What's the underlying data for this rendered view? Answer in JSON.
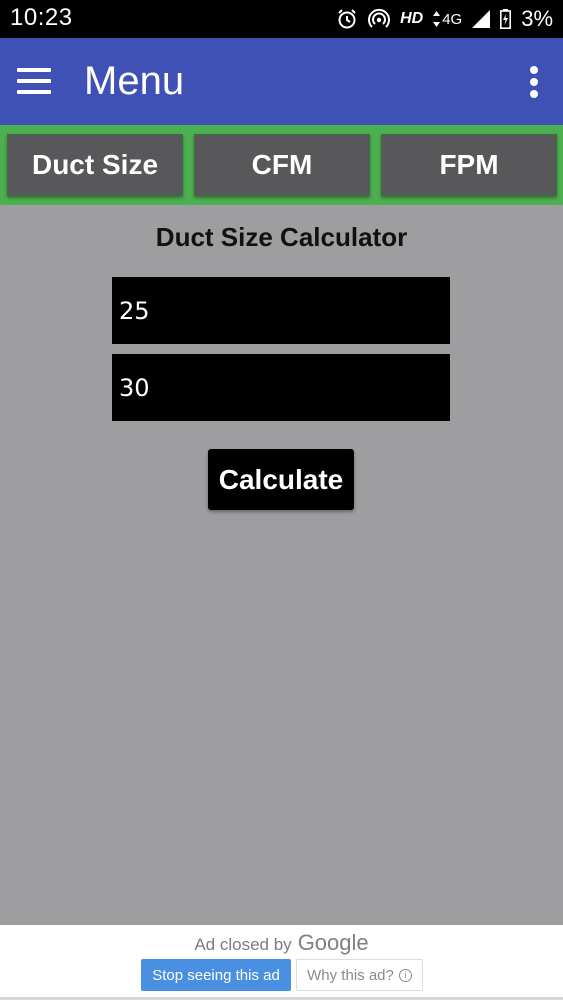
{
  "status_bar": {
    "time": "10:23",
    "network_label": "HD",
    "network_type": "4G",
    "battery": "3%"
  },
  "app_bar": {
    "title": "Menu",
    "color": "#3f51b5"
  },
  "tabs": [
    {
      "label": "Duct Size"
    },
    {
      "label": "CFM"
    },
    {
      "label": "FPM"
    }
  ],
  "tab_strip_color": "#4caf50",
  "calculator": {
    "title": "Duct Size Calculator",
    "field1_value": "25",
    "field2_value": "30",
    "button_label": "Calculate"
  },
  "ad": {
    "closed_text": "Ad closed by",
    "brand": "Google",
    "stop_label": "Stop seeing this ad",
    "why_label": "Why this ad?",
    "stop_color": "#4a90e2"
  }
}
